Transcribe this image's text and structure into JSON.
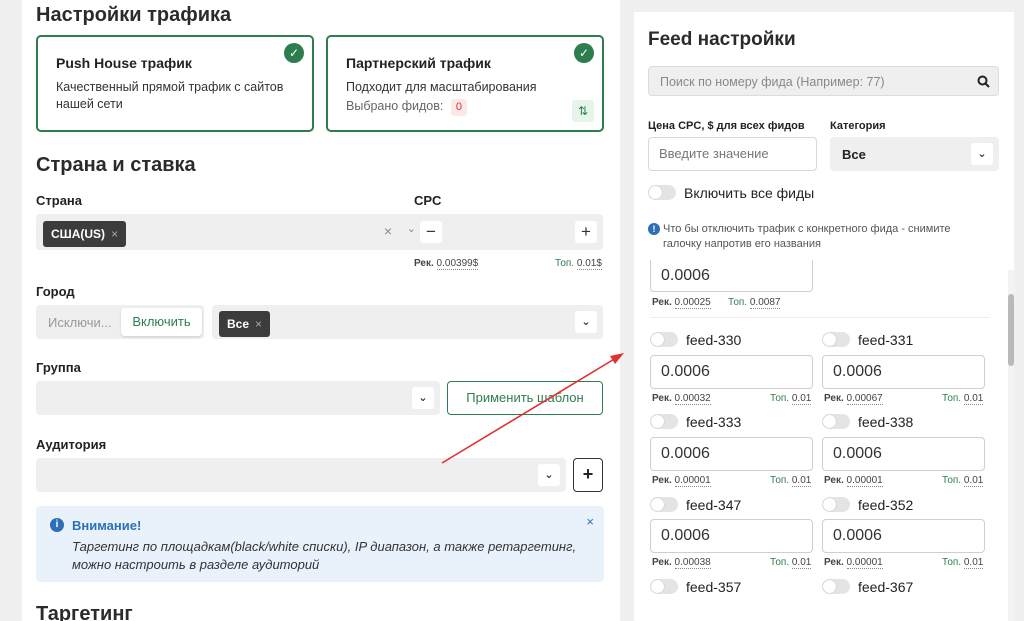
{
  "left": {
    "traffic_title": "Настройки трафика",
    "card1": {
      "title": "Push House трафик",
      "desc": "Качественный прямой трафик с сайтов нашей сети"
    },
    "card2": {
      "title": "Партнерский трафик",
      "desc": "Подходит для масштабирования",
      "selected_label": "Выбрано фидов:",
      "selected_count": "0"
    },
    "country_rate_title": "Страна и ставка",
    "country_label": "Страна",
    "country_tag": "США(US)",
    "cpc_label": "CPC",
    "cpc_minus": "−",
    "cpc_plus": "+",
    "rec_label": "Рек.",
    "rec_value": "0.00399$",
    "top_label": "Топ.",
    "top_value": "0.01$",
    "city_label": "Город",
    "city_placeholder": "Исключи...",
    "city_include_button": "Включить",
    "city_tag": "Все",
    "group_label": "Группа",
    "apply_template_button": "Применить шаблон",
    "audience_label": "Аудитория",
    "audience_add": "+",
    "notice": {
      "title": "Внимание!",
      "text": "Таргетинг по площадкам(black/white списки), IP диапазон, а также ретаргетинг, можно настроить в разделе аудиторий",
      "close": "×"
    },
    "targeting_title": "Таргетинг"
  },
  "right": {
    "title": "Feed настройки",
    "search_placeholder": "Поиск по номеру фида (Например: 77)",
    "cpc_all_label": "Цена CPC, $ для всех фидов",
    "cpc_all_placeholder": "Введите значение",
    "category_label": "Категория",
    "category_value": "Все",
    "enable_all_label": "Включить все фиды",
    "hint": "Что бы отключить трафик с конкретного фида - снимите галочку напротив его названия",
    "partial": {
      "value": "0.0006",
      "rec": "0.00025",
      "top": "0.0087"
    },
    "feeds": [
      {
        "name": "feed-330",
        "value": "0.0006",
        "rec": "0.00032",
        "top": "0.01"
      },
      {
        "name": "feed-331",
        "value": "0.0006",
        "rec": "0.00067",
        "top": "0.01"
      },
      {
        "name": "feed-333",
        "value": "0.0006",
        "rec": "0.00001",
        "top": "0.01"
      },
      {
        "name": "feed-338",
        "value": "0.0006",
        "rec": "0.00001",
        "top": "0.01"
      },
      {
        "name": "feed-347",
        "value": "0.0006",
        "rec": "0.00038",
        "top": "0.01"
      },
      {
        "name": "feed-352",
        "value": "0.0006",
        "rec": "0.00001",
        "top": "0.01"
      },
      {
        "name": "feed-357"
      },
      {
        "name": "feed-367"
      }
    ]
  },
  "colors": {
    "accent": "#2e7d4f",
    "info": "#2c6fb7",
    "arrow": "#e0312f"
  },
  "icons": {
    "check": "check-icon",
    "search": "search-icon",
    "info": "info-icon",
    "chevron": "chevron-down-icon",
    "sliders": "sliders-icon"
  }
}
